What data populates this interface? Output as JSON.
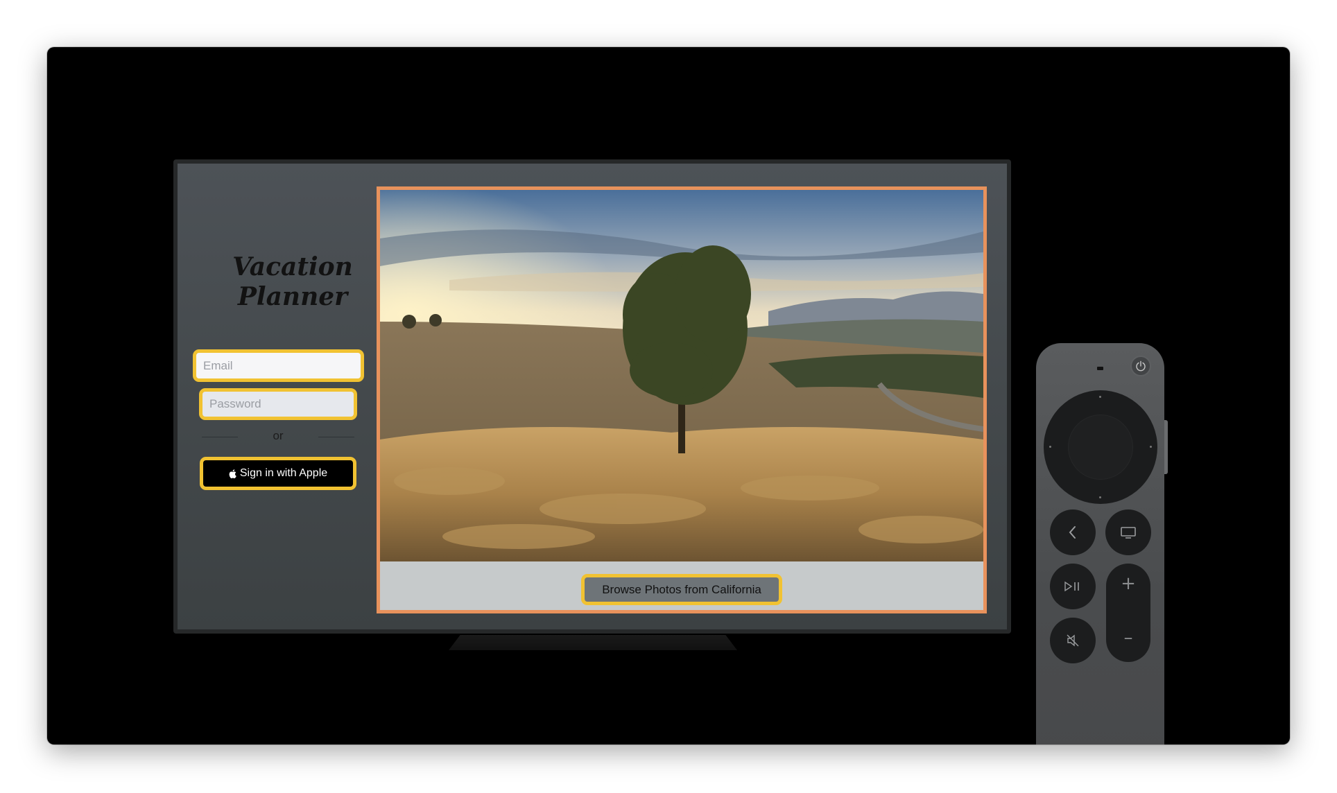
{
  "app": {
    "title_line1": "Vacation",
    "title_line2": "Planner"
  },
  "login": {
    "email_placeholder": "Email",
    "password_placeholder": "Password",
    "divider_text": "or",
    "apple_signin_label": "Sign in with Apple"
  },
  "photo_card": {
    "browse_label": "Browse Photos from California"
  },
  "colors": {
    "focus_ring": "#f1c232",
    "card_border": "#e8925c",
    "screen_bg": "#4a4f52"
  },
  "remote": {
    "buttons": [
      "power-icon",
      "back-icon",
      "tv-icon",
      "play-pause-icon",
      "volume-up-icon",
      "volume-down-icon",
      "mute-icon"
    ]
  }
}
